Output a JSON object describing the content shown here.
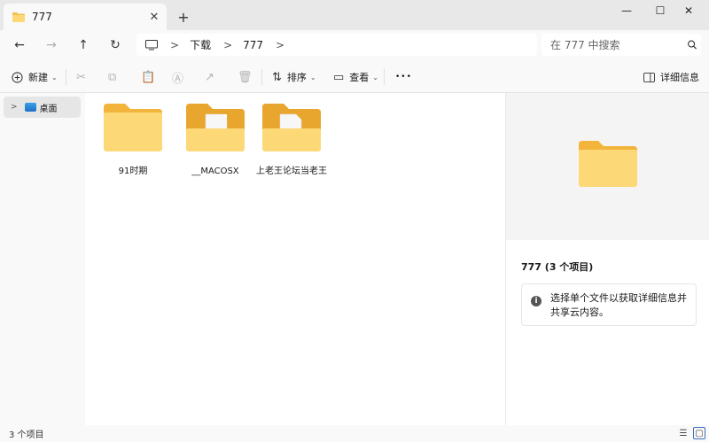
{
  "window": {
    "tab_title": "777",
    "close_tab_glyph": "✕",
    "new_tab_glyph": "+",
    "minimize_glyph": "—",
    "maximize_glyph": "☐",
    "close_glyph": "✕"
  },
  "nav": {
    "back_glyph": "←",
    "forward_glyph": "→",
    "up_glyph": "↑",
    "refresh_glyph": "↻",
    "breadcrumbs": [
      "下载",
      "777"
    ],
    "crumb_separator": ">",
    "search_placeholder": "在 777 中搜索",
    "search_glyph": "🔍"
  },
  "commands": {
    "new_label": "新建",
    "sort_label": "排序",
    "view_label": "查看",
    "more_glyph": "•••",
    "details_label": "详细信息",
    "icons": [
      "plus-circle-icon",
      "scissors-icon",
      "copy-icon",
      "paste-icon",
      "rename-icon",
      "share-icon",
      "delete-icon",
      "sort-icon",
      "view-icon",
      "details-pane-icon"
    ]
  },
  "sidebar": {
    "items": [
      {
        "label": "桌面",
        "icon": "desktop-icon",
        "selected": true
      }
    ]
  },
  "files": [
    {
      "name": "91时期",
      "type": "folder",
      "icon": "empty-folder-icon"
    },
    {
      "name": "__MACOSX",
      "type": "folder",
      "icon": "folder-with-files-icon"
    },
    {
      "name": "上老王论坛当老王",
      "type": "folder",
      "icon": "folder-with-files-icon"
    }
  ],
  "preview": {
    "title": "777 (3 个项目)",
    "info_text": "选择单个文件以获取详细信息并共享云内容。",
    "info_glyph": "i"
  },
  "status": {
    "text": "3 个项目"
  },
  "colors": {
    "folder_light": "#fcd976",
    "folder_dark": "#f2b43a",
    "accent": "#3b6fbf"
  }
}
